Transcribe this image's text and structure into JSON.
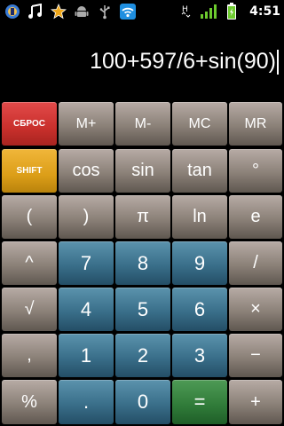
{
  "status_bar": {
    "time": "4:51",
    "icons_left": [
      "app-icon",
      "music-icon",
      "star-icon",
      "android-icon",
      "usb-icon",
      "wifi-icon"
    ],
    "icons_right": [
      "network-h-icon",
      "signal-icon",
      "battery-icon"
    ]
  },
  "display": {
    "expression": "100+597/6+sin(90)"
  },
  "keys": {
    "reset": "СБРОС",
    "m_plus": "M+",
    "m_minus": "M-",
    "mc": "MC",
    "mr": "MR",
    "shift": "SHIFT",
    "cos": "cos",
    "sin": "sin",
    "tan": "tan",
    "degree": "°",
    "open_paren": "(",
    "close_paren": ")",
    "pi": "π",
    "ln": "ln",
    "e": "e",
    "power": "^",
    "seven": "7",
    "eight": "8",
    "nine": "9",
    "divide": "/",
    "sqrt": "√",
    "four": "4",
    "five": "5",
    "six": "6",
    "multiply": "×",
    "comma": ",",
    "one": "1",
    "two": "2",
    "three": "3",
    "minus": "−",
    "percent": "%",
    "dot": ".",
    "zero": "0",
    "equals": "=",
    "plus": "+"
  },
  "colors": {
    "gray_key": "#8b8178",
    "digit_key": "#3a6f8a",
    "reset_key": "#c9302c",
    "shift_key": "#dc9e18",
    "equals_key": "#2f7a38",
    "background": "#000000"
  }
}
